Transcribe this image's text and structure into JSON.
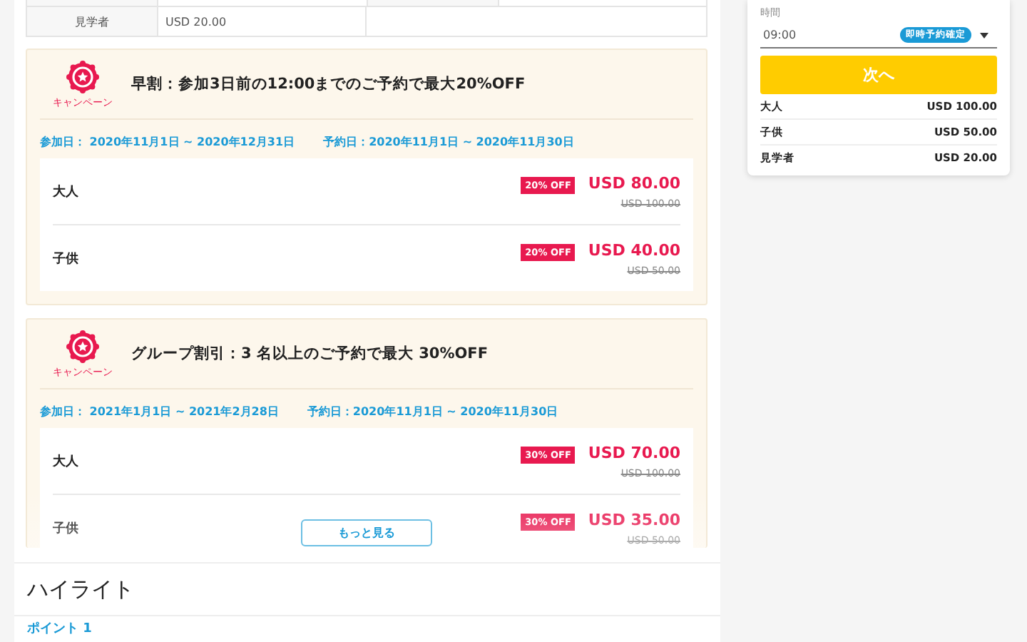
{
  "price_table": {
    "rows": [
      {
        "label": "見学者",
        "value": "USD 20.00"
      }
    ]
  },
  "campaigns": [
    {
      "badge_label": "キャンペーン",
      "title": "早割：参加3日前の12:00までのご予約で最大20%OFF",
      "participation": "参加日： 2020年11月1日 ~ 2020年12月31日",
      "booking": "予約日：2020年11月1日 ~ 2020年11月30日",
      "collapsed": false,
      "prices": [
        {
          "label": "大人",
          "discount": "20% OFF",
          "price": "USD 80.00",
          "original": "USD 100.00"
        },
        {
          "label": "子供",
          "discount": "20% OFF",
          "price": "USD 40.00",
          "original": "USD 50.00"
        }
      ]
    },
    {
      "badge_label": "キャンペーン",
      "title": "グループ割引：3 名以上のご予約で最大 30%OFF",
      "participation": "参加日： 2021年1月1日 ~ 2021年2月28日",
      "booking": "予約日：2020年11月1日 ~ 2020年11月30日",
      "collapsed": true,
      "prices": [
        {
          "label": "大人",
          "discount": "30% OFF",
          "price": "USD 70.00",
          "original": "USD 100.00"
        },
        {
          "label": "子供",
          "discount": "30% OFF",
          "price": "USD 35.00",
          "original": "USD 50.00"
        }
      ]
    }
  ],
  "more_button": "もっと見る",
  "highlight": {
    "title": "ハイライト",
    "point": "ポイント 1"
  },
  "sidebar": {
    "time_label": "時間",
    "time_value": "09:00",
    "instant_badge": "即時予約確定",
    "next_button": "次へ",
    "prices": [
      {
        "label": "大人",
        "value": "USD 100.00"
      },
      {
        "label": "子供",
        "value": "USD 50.00"
      },
      {
        "label": "見学者",
        "value": "USD 20.00"
      }
    ]
  }
}
